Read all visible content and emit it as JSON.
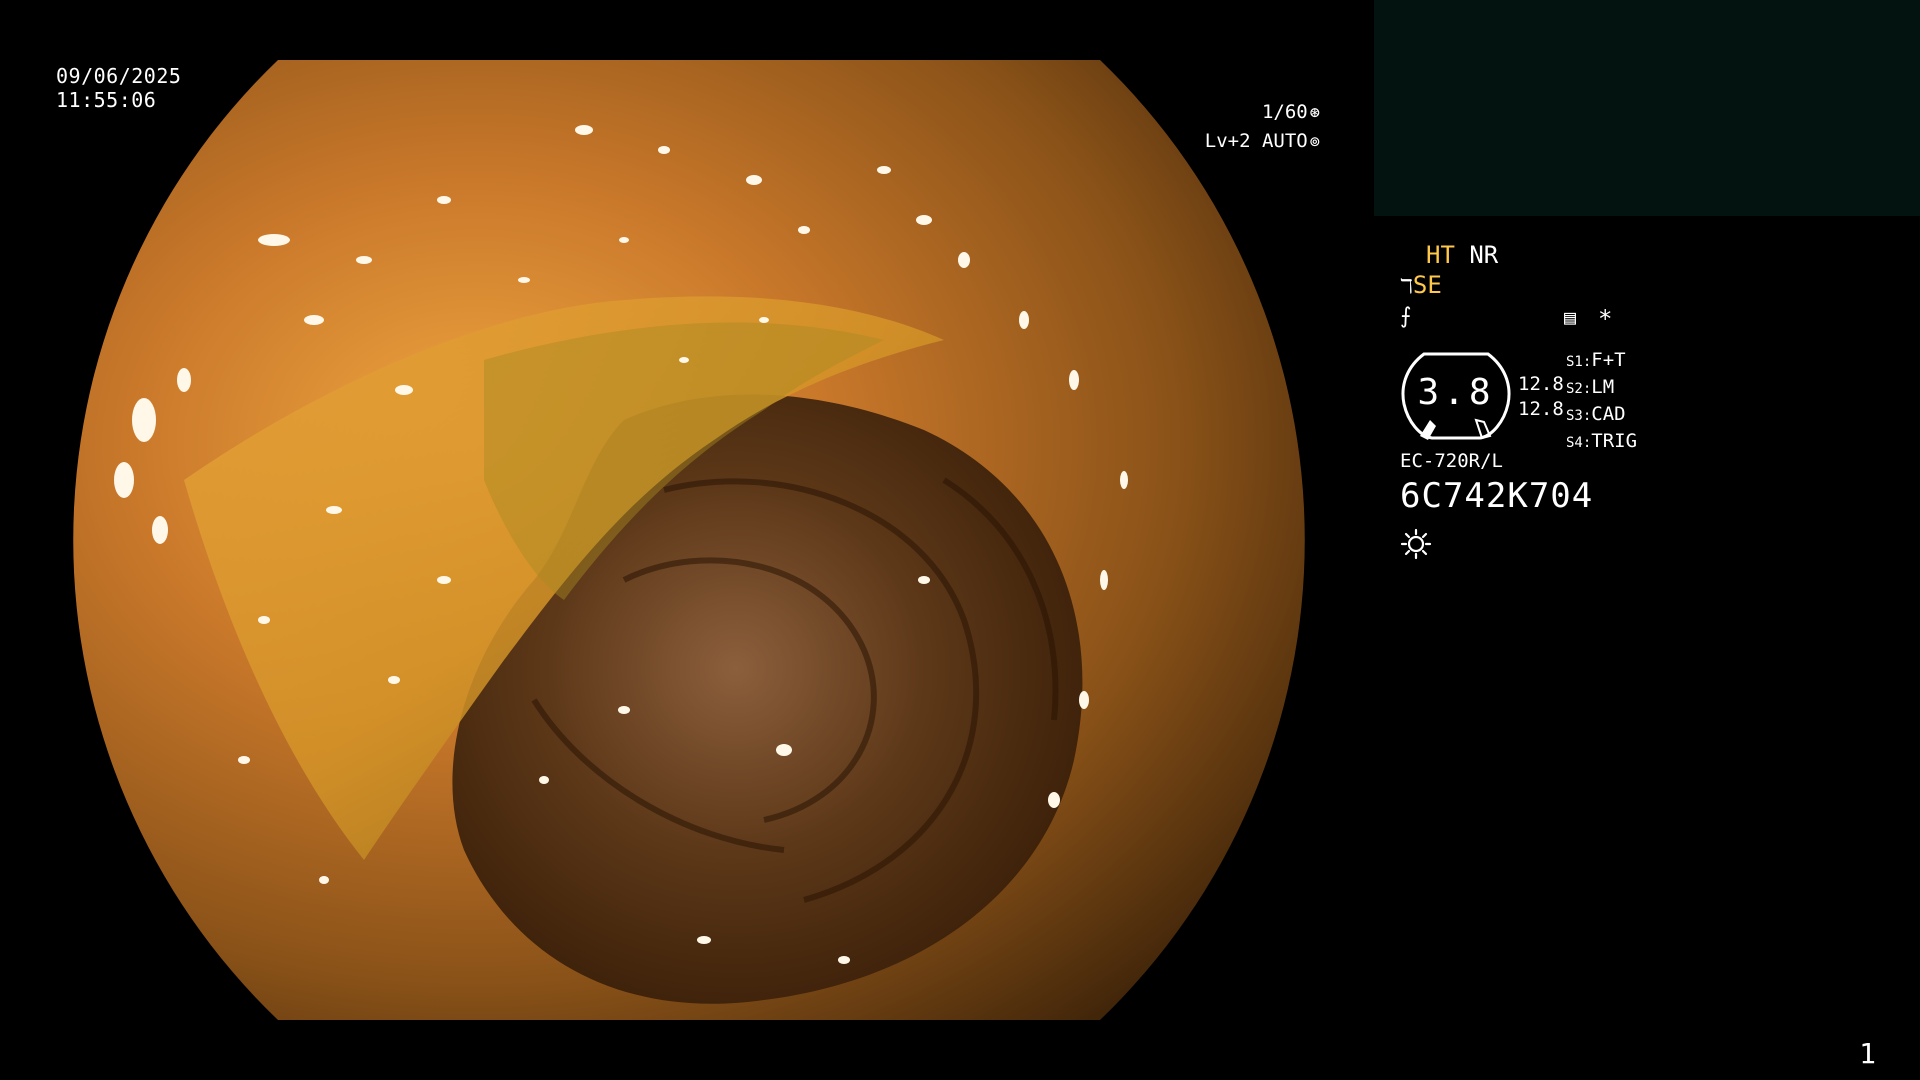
{
  "overlay": {
    "date": "09/06/2025",
    "time": "11:55:06",
    "shutter": "1/60",
    "shutter_icon": "aperture-icon",
    "level": "Lv+2 AUTO",
    "level_icon": "iris-icon"
  },
  "status": {
    "ht": "HT",
    "nr": "NR",
    "se": "SE",
    "se_icon": "wave-icon",
    "flash_icon": "slash-f-icon",
    "menu_icon": "menu-card-icon",
    "star": "*",
    "gauge_value": "3.8",
    "stat_a": "12.8",
    "stat_b": "12.8",
    "switches": [
      {
        "key": "S1:",
        "value": "F+T"
      },
      {
        "key": "S2:",
        "value": "LM"
      },
      {
        "key": "S3:",
        "value": "CAD"
      },
      {
        "key": "S4:",
        "value": "TRIG"
      }
    ],
    "scope_model": "EC-720R/L",
    "serial": "6C742K704",
    "light_icon": "sun-icon"
  },
  "page_number": "1",
  "colors": {
    "accent_yellow": "#ffc84a",
    "background": "#000000",
    "secondary_monitor": "#031410"
  }
}
